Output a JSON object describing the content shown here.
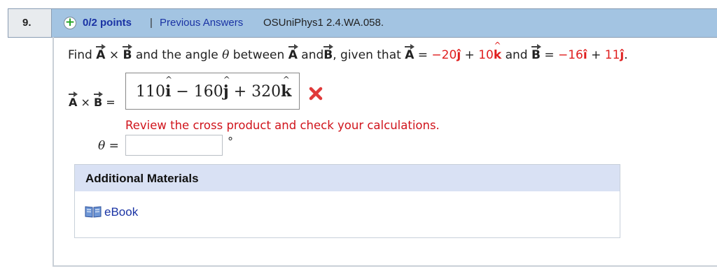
{
  "question": {
    "number": "9.",
    "points": "0/2 points",
    "separator": "|",
    "previous_answers": "Previous Answers",
    "question_id": "OSUniPhys1 2.4.WA.058."
  },
  "problem": {
    "find": "Find",
    "vecA": "A",
    "times": "×",
    "vecB": "B",
    "and_angle": "and the angle",
    "theta": "θ",
    "between": "between",
    "and": "and",
    "given_that": ", given that",
    "equals": "=",
    "a_j_coef": "−20",
    "j_hat": "ĵ",
    "plus": "+",
    "a_k_coef": "10",
    "k_char": "k",
    "hat_char": "^",
    "and2": "and",
    "b_i_coef": "−16",
    "i_hat": "î",
    "b_j_coef": "11",
    "period": "."
  },
  "cross_answer": {
    "label_eq": "=",
    "c1": "110",
    "i": "i",
    "minus": " − ",
    "c2": "160",
    "j": "j",
    "plus": " + ",
    "c3": "320",
    "k": "k",
    "status": "incorrect",
    "status_icon": "x-icon"
  },
  "feedback": "Review the cross product and check your calculations.",
  "theta_field": {
    "label": "θ",
    "eq": "=",
    "value": "",
    "unit": "°"
  },
  "additional_materials": {
    "heading": "Additional Materials",
    "links": [
      {
        "label": "eBook",
        "icon": "book-icon"
      }
    ]
  },
  "colors": {
    "header_bg": "#a3c4e2",
    "accent_link": "#1a33a4",
    "error_red": "#e01f1f",
    "success_green": "#26a325",
    "materials_head_bg": "#d9e1f4"
  }
}
